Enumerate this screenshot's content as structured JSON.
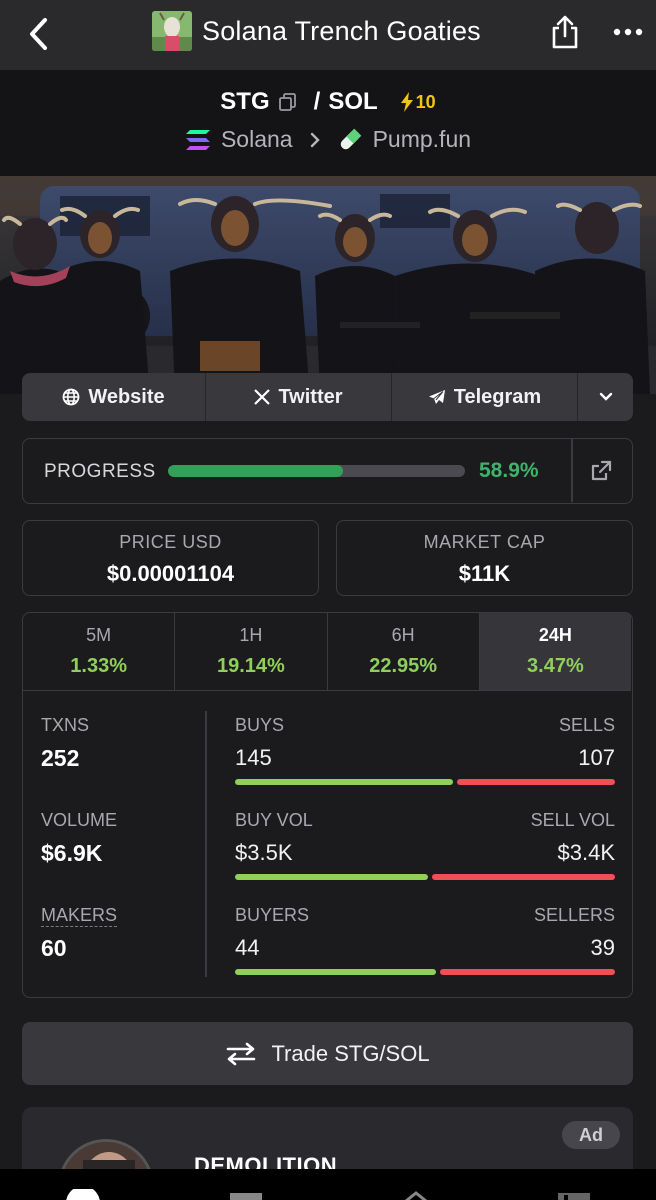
{
  "header": {
    "title": "Solana Trench Goaties",
    "back_icon": "chevron-left-icon",
    "share_icon": "share-icon",
    "more_icon": "more-dots-icon"
  },
  "pair": {
    "base": "STG",
    "separator": "/",
    "quote": "SOL",
    "boost": "10",
    "chain": "Solana",
    "dex": "Pump.fun"
  },
  "links": {
    "website": "Website",
    "twitter": "Twitter",
    "telegram": "Telegram"
  },
  "progress": {
    "label": "PROGRESS",
    "value": "58.9%",
    "fraction": 0.589
  },
  "price": {
    "label": "PRICE USD",
    "value": "$0.00001104"
  },
  "market_cap": {
    "label": "MARKET CAP",
    "value": "$11K"
  },
  "timeframes": [
    {
      "name": "5M",
      "change": "1.33%"
    },
    {
      "name": "1H",
      "change": "19.14%"
    },
    {
      "name": "6H",
      "change": "22.95%"
    },
    {
      "name": "24H",
      "change": "3.47%",
      "active": true
    }
  ],
  "metrics": {
    "txns_label": "TXNS",
    "txns_value": "252",
    "volume_label": "VOLUME",
    "volume_value": "$6.9K",
    "makers_label": "MAKERS",
    "makers_value": "60"
  },
  "splits": {
    "buys_label": "BUYS",
    "buys_value": "145",
    "sells_label": "SELLS",
    "sells_value": "107",
    "buy_vol_label": "BUY VOL",
    "buy_vol_value": "$3.5K",
    "sell_vol_label": "SELL VOL",
    "sell_vol_value": "$3.4K",
    "buyers_label": "BUYERS",
    "buyers_value": "44",
    "sellers_label": "SELLERS",
    "sellers_value": "39"
  },
  "trade": {
    "label": "Trade STG/SOL"
  },
  "ad": {
    "badge": "Ad",
    "title": "DEMOLITION"
  },
  "colors": {
    "accent_green": "#3fb36a",
    "change_green": "#8fcf5a",
    "sell_red": "#ef4f55",
    "boost_yellow": "#f3c316"
  }
}
